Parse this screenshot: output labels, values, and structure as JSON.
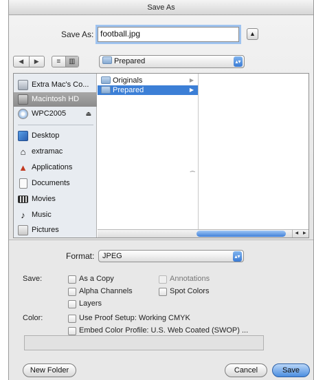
{
  "window": {
    "title": "Save As"
  },
  "save_as": {
    "label": "Save As:",
    "filename": "football.jpg"
  },
  "toolbar": {
    "back_glyph": "◀",
    "forward_glyph": "▶",
    "list_view_glyph": "≡",
    "column_view_glyph": "▥",
    "location": "Prepared",
    "expand_glyph": "▲",
    "popup_glyph": "▴▾"
  },
  "sidebar": {
    "devices": [
      {
        "label": "Extra Mac's Co...",
        "icon": "computer-icon"
      },
      {
        "label": "Macintosh HD",
        "icon": "hard-disk-icon",
        "selected": true
      },
      {
        "label": "WPC2005",
        "icon": "disc-icon",
        "eject": "⏏"
      }
    ],
    "places": [
      {
        "label": "Desktop",
        "icon": "desktop-icon"
      },
      {
        "label": "extramac",
        "icon": "home-icon"
      },
      {
        "label": "Applications",
        "icon": "applications-icon"
      },
      {
        "label": "Documents",
        "icon": "documents-icon"
      },
      {
        "label": "Movies",
        "icon": "movies-icon"
      },
      {
        "label": "Music",
        "icon": "music-icon"
      },
      {
        "label": "Pictures",
        "icon": "pictures-icon"
      }
    ]
  },
  "column_browser": {
    "column1": [
      {
        "label": "Originals",
        "selected": false
      },
      {
        "label": "Prepared",
        "selected": true
      }
    ],
    "arrow_glyph": "▶",
    "scroll_left_glyph": "◀",
    "scroll_right_glyph": "▶"
  },
  "format": {
    "label": "Format:",
    "value": "JPEG"
  },
  "options": {
    "save_label": "Save:",
    "as_a_copy": "As a Copy",
    "alpha_channels": "Alpha Channels",
    "layers": "Layers",
    "annotations": "Annotations",
    "spot_colors": "Spot Colors",
    "color_label": "Color:",
    "use_proof_setup": "Use Proof Setup:  Working CMYK",
    "embed_color_profile": "Embed Color Profile:  U.S. Web Coated (SWOP) ..."
  },
  "buttons": {
    "new_folder": "New Folder",
    "cancel": "Cancel",
    "save": "Save"
  },
  "colors": {
    "selection_blue": "#3c7fd6",
    "sidebar_selected": "#8c8c8c"
  }
}
